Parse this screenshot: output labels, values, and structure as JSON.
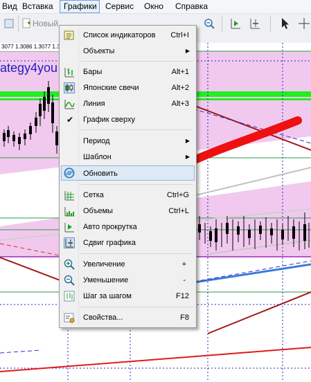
{
  "menubar": {
    "items": [
      "Вид",
      "Вставка",
      "Графики",
      "Сервис",
      "Окно",
      "Справка"
    ]
  },
  "toolbar": {
    "new_label": "Новый"
  },
  "chart": {
    "price_strip": "3077 1.3086 1.3077 1.3",
    "watermark": "ategy4you"
  },
  "menu": {
    "items": [
      {
        "label": "Список индикаторов",
        "shortcut": "Ctrl+I",
        "icon": "indicator-list-icon"
      },
      {
        "label": "Объекты",
        "submenu": true
      },
      {
        "label": "Бары",
        "shortcut": "Alt+1",
        "icon": "bar-chart-icon"
      },
      {
        "label": "Японские свечи",
        "shortcut": "Alt+2",
        "icon": "candlestick-icon"
      },
      {
        "label": "Линия",
        "shortcut": "Alt+3",
        "icon": "line-chart-icon"
      },
      {
        "label": "График сверху",
        "checked": true
      },
      {
        "label": "Период",
        "submenu": true
      },
      {
        "label": "Шаблон",
        "submenu": true
      },
      {
        "label": "Обновить",
        "icon": "refresh-icon",
        "highlighted": true
      },
      {
        "label": "Сетка",
        "shortcut": "Ctrl+G",
        "icon": "grid-icon"
      },
      {
        "label": "Объемы",
        "shortcut": "Ctrl+L",
        "icon": "volumes-icon"
      },
      {
        "label": "Авто прокрутка",
        "icon": "auto-scroll-icon"
      },
      {
        "label": "Сдвиг графика",
        "icon": "chart-shift-icon"
      },
      {
        "label": "Увеличение",
        "shortcut": "+",
        "icon": "zoom-in-icon"
      },
      {
        "label": "Уменьшение",
        "shortcut": "-",
        "icon": "zoom-out-icon"
      },
      {
        "label": "Шаг за шагом",
        "shortcut": "F12",
        "icon": "step-by-step-icon"
      },
      {
        "label": "Свойства...",
        "shortcut": "F8",
        "icon": "properties-icon"
      }
    ]
  },
  "colors": {
    "pink_zone": "#f2c9ee",
    "green_band": "#22ee22",
    "red_arrow": "#ee1111",
    "menu_highlight": "#dde9f5"
  }
}
